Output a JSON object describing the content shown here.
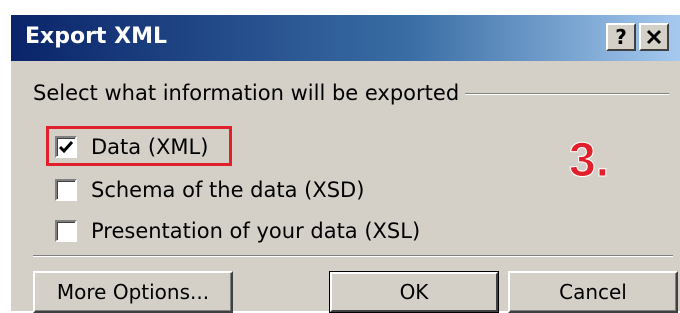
{
  "window": {
    "title": "Export XML",
    "help_label": "?",
    "close_icon": "close-icon"
  },
  "group": {
    "label": "Select what information will be exported"
  },
  "options": [
    {
      "label": "Data (XML)",
      "checked": true
    },
    {
      "label": "Schema of the data (XSD)",
      "checked": false
    },
    {
      "label": "Presentation of your data (XSL)",
      "checked": false
    }
  ],
  "annotation": {
    "step": "3.",
    "color": "#e0202a"
  },
  "buttons": {
    "more_options": "More Options...",
    "ok": "OK",
    "cancel": "Cancel"
  },
  "colors": {
    "titlebar_start": "#0a246a",
    "titlebar_end": "#a6caf0",
    "dialog_bg": "#d4d0c8"
  }
}
